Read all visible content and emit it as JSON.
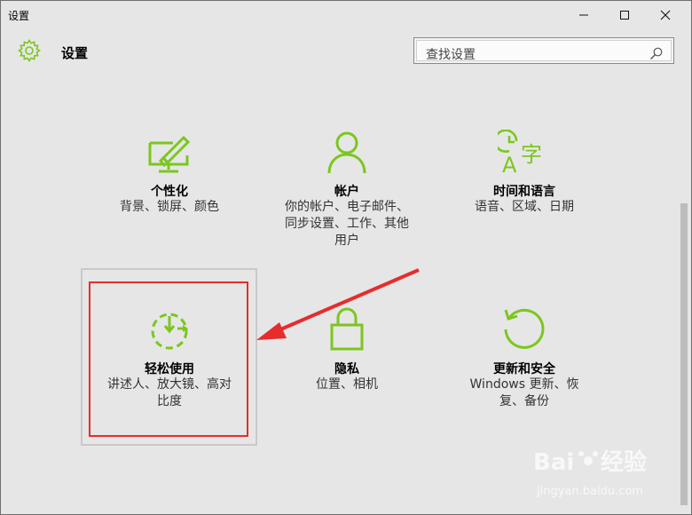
{
  "window": {
    "title": "设置"
  },
  "header": {
    "app_title": "设置"
  },
  "search": {
    "placeholder": "查找设置"
  },
  "tiles": [
    {
      "id": "personalization",
      "label": "个性化",
      "desc_lines": [
        "背景、锁屏、颜色"
      ],
      "icon": "personalization-icon"
    },
    {
      "id": "accounts",
      "label": "帐户",
      "desc_lines": [
        "你的帐户、电子邮件、",
        "同步设置、工作、其他",
        "用户"
      ],
      "icon": "person-icon"
    },
    {
      "id": "time-language",
      "label": "时间和语言",
      "desc_lines": [
        "语音、区域、日期"
      ],
      "icon": "time-language-icon"
    },
    {
      "id": "ease-of-access",
      "label": "轻松使用",
      "desc_lines": [
        "讲述人、放大镜、高对",
        "比度"
      ],
      "icon": "ease-of-access-icon"
    },
    {
      "id": "privacy",
      "label": "隐私",
      "desc_lines": [
        "位置、相机"
      ],
      "icon": "lock-icon"
    },
    {
      "id": "update-security",
      "label": "更新和安全",
      "desc_lines": [
        "Windows 更新、恢",
        "复、备份"
      ],
      "icon": "refresh-icon"
    }
  ],
  "watermark": {
    "text": "jingyan.baidu.com"
  },
  "colors": {
    "accent": "#7cc61f",
    "highlight": "#e52d2d",
    "background": "#e6e6e6"
  }
}
